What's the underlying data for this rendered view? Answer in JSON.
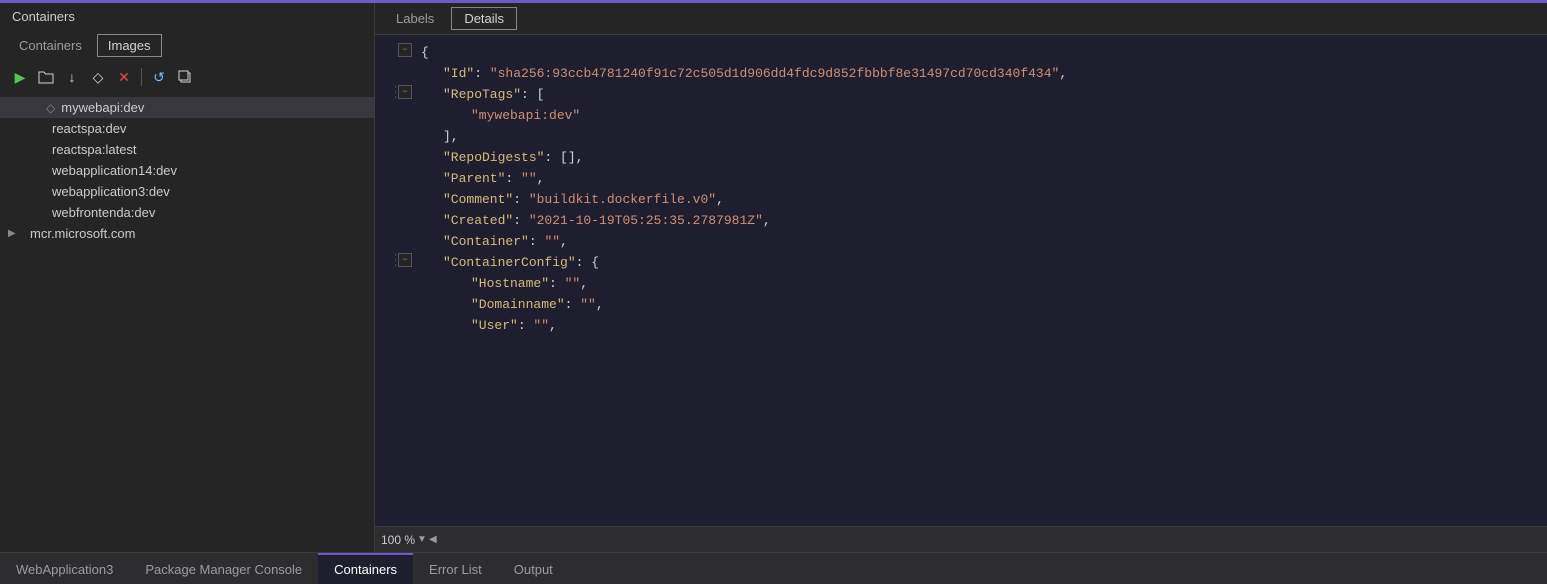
{
  "window": {
    "title": "Containers"
  },
  "left_panel": {
    "title": "Containers",
    "tabs": [
      {
        "label": "Containers",
        "active": false
      },
      {
        "label": "Images",
        "active": true
      }
    ],
    "toolbar": {
      "play_btn": "▶",
      "folder_btn": "🗁",
      "download_btn": "↓",
      "tag_btn": "◇",
      "delete_btn": "✕",
      "refresh_btn": "↺",
      "copy_btn": "❐"
    },
    "images": [
      {
        "name": "mywebapi:dev",
        "selected": true,
        "icon": "◇",
        "expandable": false
      },
      {
        "name": "reactspa:dev",
        "selected": false,
        "icon": "",
        "expandable": false
      },
      {
        "name": "reactspa:latest",
        "selected": false,
        "icon": "",
        "expandable": false
      },
      {
        "name": "webapplication14:dev",
        "selected": false,
        "icon": "",
        "expandable": false
      },
      {
        "name": "webapplication3:dev",
        "selected": false,
        "icon": "",
        "expandable": false
      },
      {
        "name": "webfrontenda:dev",
        "selected": false,
        "icon": "",
        "expandable": false
      },
      {
        "name": "mcr.microsoft.com",
        "selected": false,
        "icon": "",
        "expandable": true
      }
    ]
  },
  "right_panel": {
    "tabs": [
      {
        "label": "Labels",
        "active": false
      },
      {
        "label": "Details",
        "active": true
      }
    ],
    "json_lines": [
      {
        "indent": 0,
        "collapsible": true,
        "content": "{",
        "key": "",
        "value": ""
      },
      {
        "indent": 1,
        "collapsible": false,
        "content": "\"Id\": \"sha256:93ccb4781240f91c72c505d1d906dd4fdc9d852fbbbf8e31497cd70cd340f434\",",
        "key": "Id",
        "value": "sha256:93ccb4781240f91c72c505d1d906dd4fdc9d852fbbbf8e31497cd70cd340f434"
      },
      {
        "indent": 1,
        "collapsible": true,
        "content": "\"RepoTags\": [",
        "key": "RepoTags",
        "value": "["
      },
      {
        "indent": 2,
        "collapsible": false,
        "content": "\"mywebapi:dev\"",
        "key": "",
        "value": "mywebapi:dev"
      },
      {
        "indent": 1,
        "collapsible": false,
        "content": "],",
        "key": "",
        "value": ""
      },
      {
        "indent": 1,
        "collapsible": false,
        "content": "\"RepoDigests\": [],",
        "key": "RepoDigests",
        "value": "[]"
      },
      {
        "indent": 1,
        "collapsible": false,
        "content": "\"Parent\": \"\",",
        "key": "Parent",
        "value": ""
      },
      {
        "indent": 1,
        "collapsible": false,
        "content": "\"Comment\": \"buildkit.dockerfile.v0\",",
        "key": "Comment",
        "value": "buildkit.dockerfile.v0"
      },
      {
        "indent": 1,
        "collapsible": false,
        "content": "\"Created\": \"2021-10-19T05:25:35.2787981Z\",",
        "key": "Created",
        "value": "2021-10-19T05:25:35.2787981Z"
      },
      {
        "indent": 1,
        "collapsible": false,
        "content": "\"Container\": \"\",",
        "key": "Container",
        "value": ""
      },
      {
        "indent": 1,
        "collapsible": true,
        "content": "\"ContainerConfig\": {",
        "key": "ContainerConfig",
        "value": "{"
      },
      {
        "indent": 2,
        "collapsible": false,
        "content": "\"Hostname\": \"\",",
        "key": "Hostname",
        "value": ""
      },
      {
        "indent": 2,
        "collapsible": false,
        "content": "\"Domainname\": \"\",",
        "key": "Domainname",
        "value": ""
      },
      {
        "indent": 2,
        "collapsible": false,
        "content": "\"User\": \"\",",
        "key": "User",
        "value": ""
      }
    ],
    "zoom": "100 %"
  },
  "bottom_tabs": [
    {
      "label": "WebApplication3",
      "active": false
    },
    {
      "label": "Package Manager Console",
      "active": false
    },
    {
      "label": "Containers",
      "active": true
    },
    {
      "label": "Error List",
      "active": false
    },
    {
      "label": "Output",
      "active": false
    }
  ],
  "colors": {
    "bg": "#1e1e2e",
    "panel_bg": "#252526",
    "accent": "#6a5acd",
    "key_color": "#d7ba7d",
    "string_color": "#ce9178",
    "text": "#d4d4d4",
    "selected_bg": "#37373d"
  }
}
